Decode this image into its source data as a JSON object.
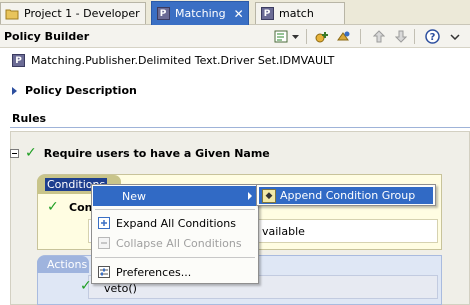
{
  "tabs": [
    {
      "label": "Project 1 - Developer",
      "icon": "folder-icon"
    },
    {
      "label": "Matching",
      "icon": "policy-icon",
      "active": true
    },
    {
      "label": "match",
      "icon": "policy-icon"
    }
  ],
  "tab_close_glyph": "✕",
  "policy_builder": {
    "title": "Policy Builder",
    "toolbar_icons": [
      "edit-icon",
      "dropdown-icon",
      "new-rule-icon",
      "copy-icon",
      "move-up-icon",
      "move-down-icon",
      "help-icon",
      "view-menu-icon"
    ]
  },
  "driver_path": "Matching.Publisher.Delimited Text.Driver Set.IDMVAULT",
  "policy_description_label": "Policy Description",
  "rules_label": "Rules",
  "rule": {
    "title": "Require users to have a Given Name",
    "conditions_tab": "Conditions",
    "condition_text_partial": "Con",
    "condition_value_partial": "vailable",
    "actions_tab": "Actions",
    "action_text_partial": "veto()"
  },
  "context_menu": {
    "items": [
      {
        "label": "New",
        "highlighted": true,
        "has_submenu": true
      },
      {
        "label": "Expand All Conditions",
        "disabled": false
      },
      {
        "label": "Collapse All Conditions",
        "disabled": true
      },
      {
        "label": "Preferences...",
        "disabled": false
      }
    ],
    "submenu": {
      "label": "Append Condition Group"
    }
  },
  "colors": {
    "selection": "#316ac5",
    "active_tab": "#3a6fc4",
    "check": "#1e9e22",
    "conditions_bg": "#fffde2",
    "actions_bg": "#dfe7f5"
  }
}
